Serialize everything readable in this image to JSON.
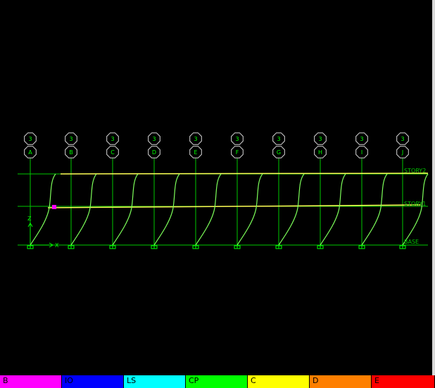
{
  "grid_bubbles": [
    {
      "top": "3",
      "bottom": "A"
    },
    {
      "top": "3",
      "bottom": "B"
    },
    {
      "top": "3",
      "bottom": "C"
    },
    {
      "top": "3",
      "bottom": "D"
    },
    {
      "top": "3",
      "bottom": "E"
    },
    {
      "top": "3",
      "bottom": "F"
    },
    {
      "top": "3",
      "bottom": "G"
    },
    {
      "top": "3",
      "bottom": "H"
    },
    {
      "top": "3",
      "bottom": "I"
    },
    {
      "top": "3",
      "bottom": "J"
    }
  ],
  "story_labels": [
    "STORY2",
    "STORY1",
    "BASE"
  ],
  "axes": {
    "z_label": "Z",
    "x_label": "X"
  },
  "colors": {
    "grid": "#00c800",
    "deformed_shape": "#7dff5a",
    "story_line": "#ffff55",
    "hinge": "#ff00ff"
  },
  "legend": [
    {
      "label": "B",
      "color": "#ff00ff"
    },
    {
      "label": "IO",
      "color": "#0000ff"
    },
    {
      "label": "LS",
      "color": "#00ffff"
    },
    {
      "label": "CP",
      "color": "#00ff00"
    },
    {
      "label": "C",
      "color": "#ffff00"
    },
    {
      "label": "D",
      "color": "#ff7f00"
    },
    {
      "label": "E",
      "color": "#ff0000"
    }
  ]
}
